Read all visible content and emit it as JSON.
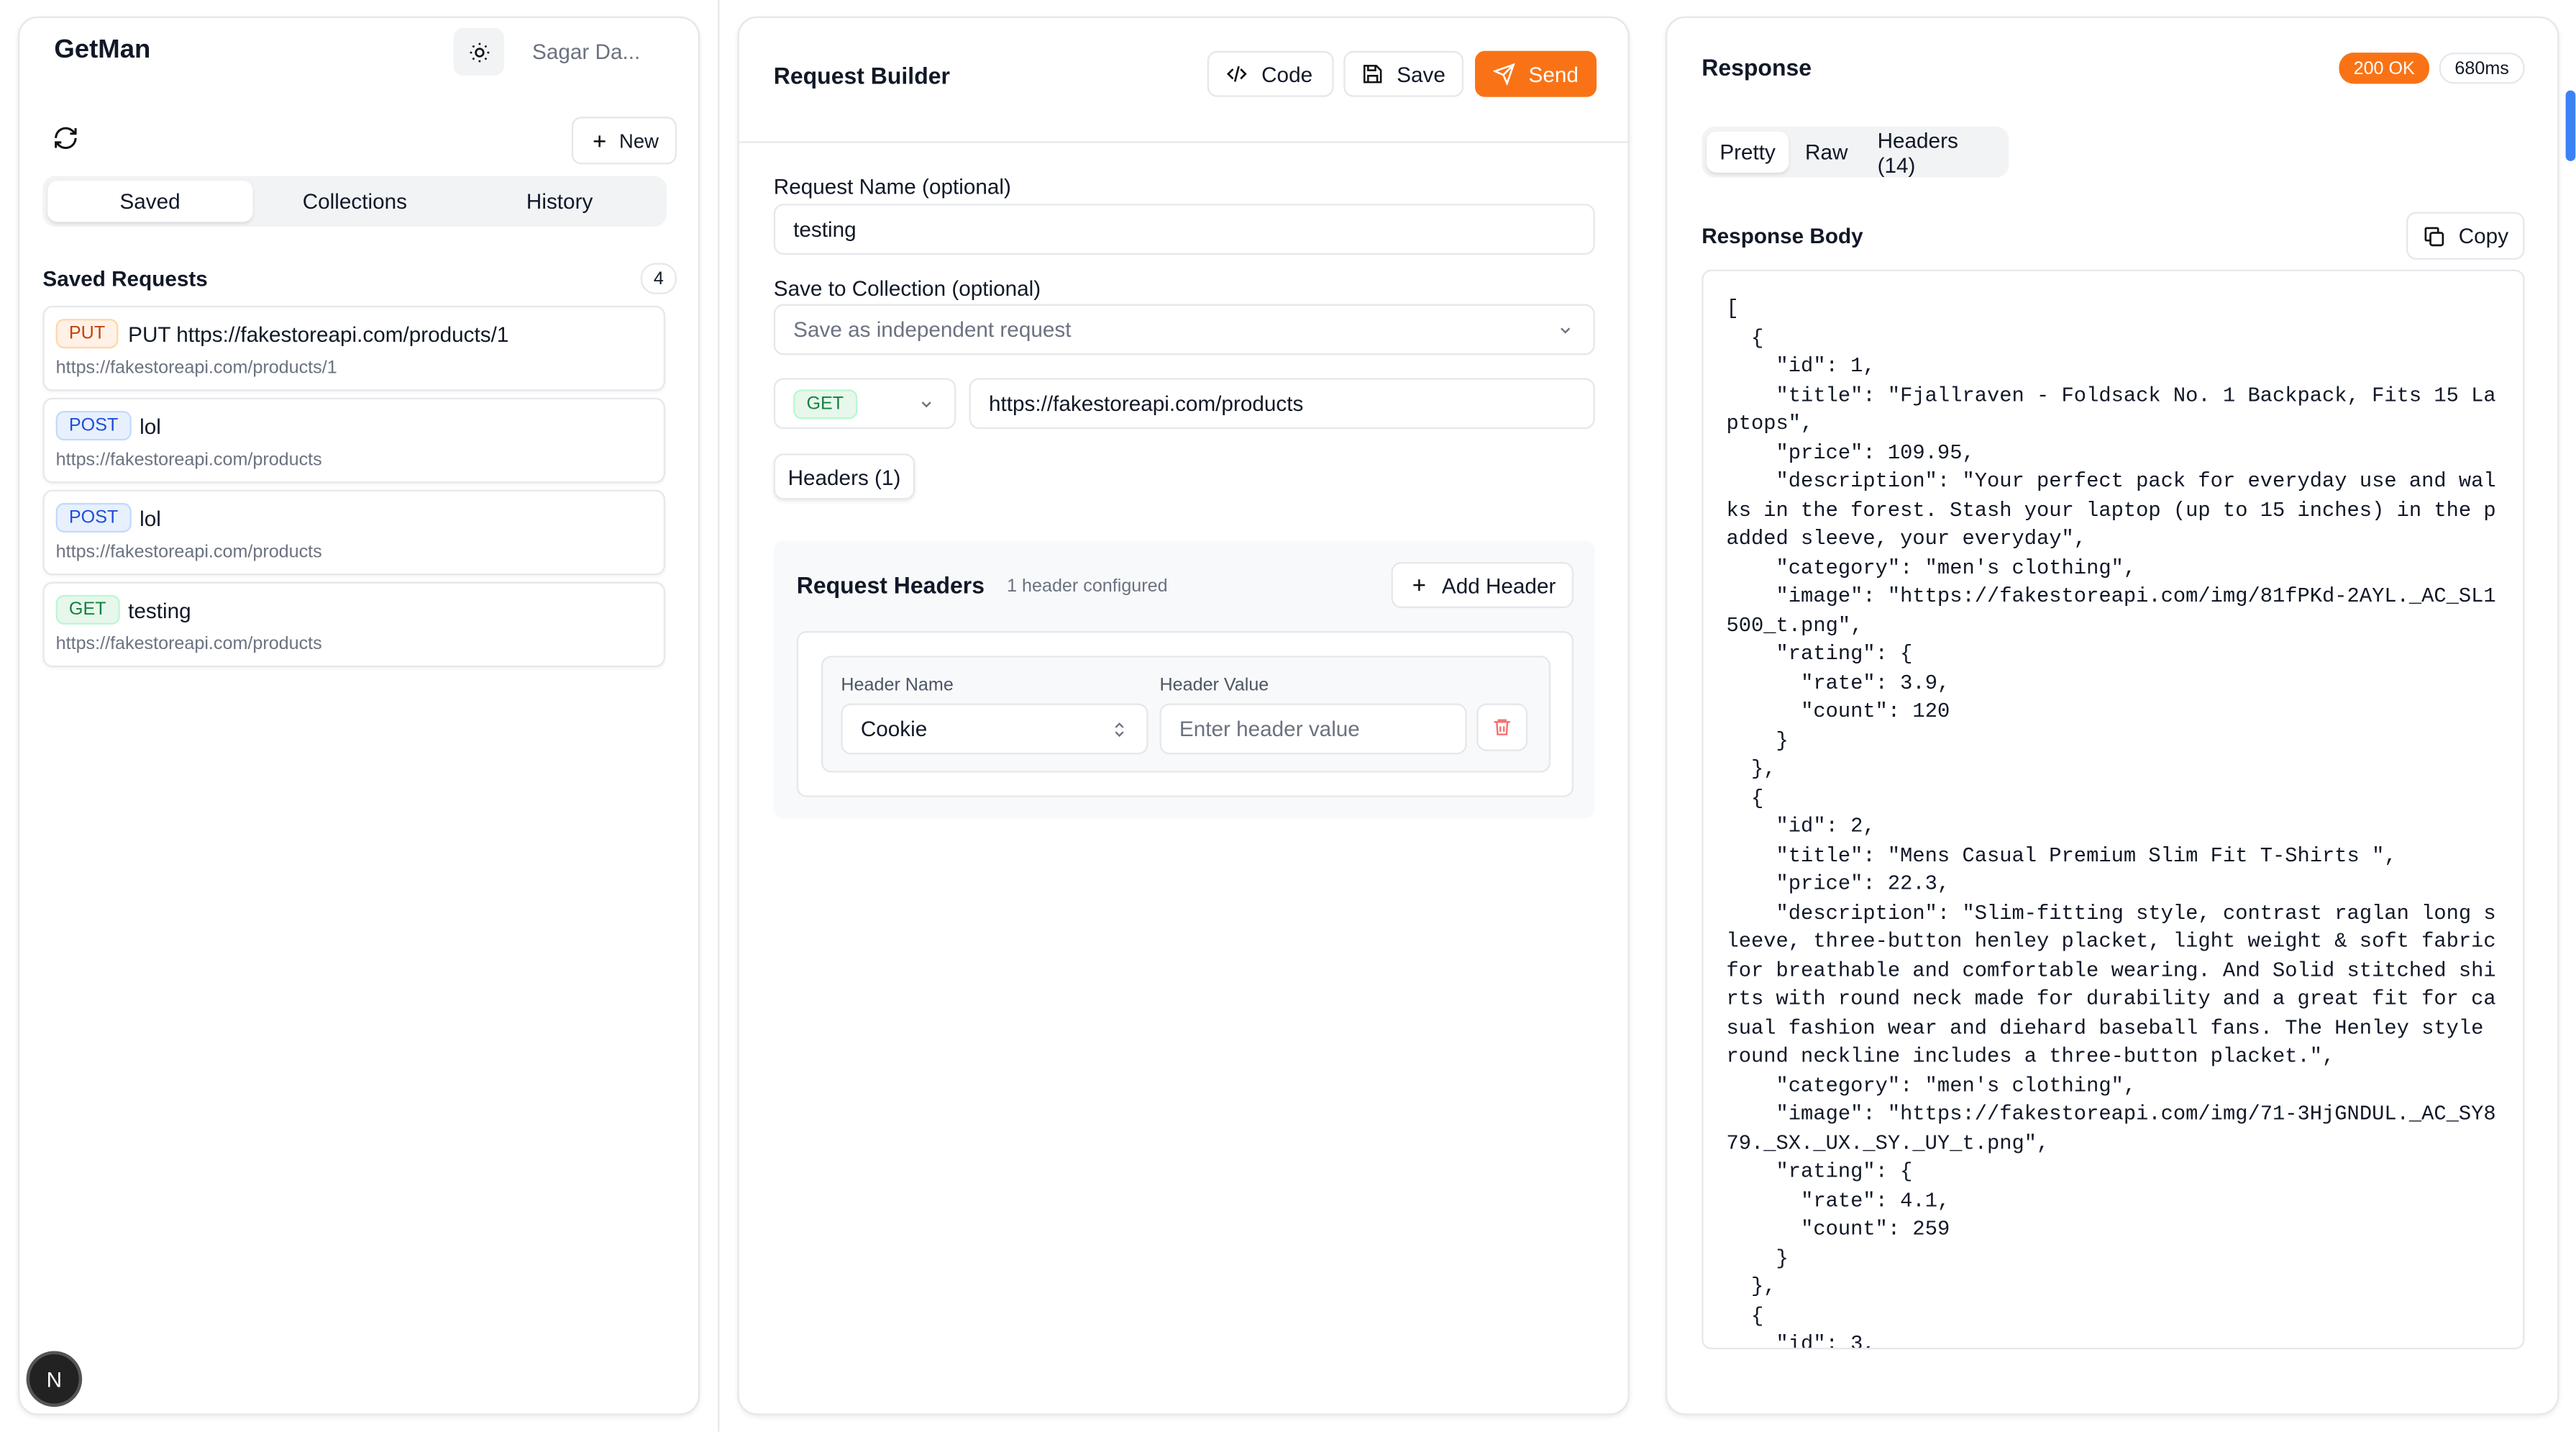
{
  "sidebar": {
    "brand": "GetMan",
    "user": "Sagar Da...",
    "new_label": "New",
    "tabs": [
      "Saved",
      "Collections",
      "History"
    ],
    "section_title": "Saved Requests",
    "count": "4",
    "requests": [
      {
        "method": "PUT",
        "name": "PUT https://fakestoreapi.com/products/1",
        "url": "https://fakestoreapi.com/products/1"
      },
      {
        "method": "POST",
        "name": "lol",
        "url": "https://fakestoreapi.com/products"
      },
      {
        "method": "POST",
        "name": "lol",
        "url": "https://fakestoreapi.com/products"
      },
      {
        "method": "GET",
        "name": "testing",
        "url": "https://fakestoreapi.com/products"
      }
    ],
    "fab_label": "N"
  },
  "builder": {
    "title": "Request Builder",
    "code_label": "Code",
    "save_label": "Save",
    "send_label": "Send",
    "name_label": "Request Name (optional)",
    "name_value": "testing",
    "collection_label": "Save to Collection (optional)",
    "collection_placeholder": "Save as independent request",
    "method": "GET",
    "url": "https://fakestoreapi.com/products",
    "headers_tab": "Headers (1)",
    "headers_section": {
      "title": "Request Headers",
      "subtitle": "1 header configured",
      "add_label": "Add Header",
      "name_label": "Header Name",
      "value_label": "Header Value",
      "name_value": "Cookie",
      "value_placeholder": "Enter header value"
    }
  },
  "response": {
    "title": "Response",
    "status": "200 OK",
    "time": "680ms",
    "tabs": [
      "Pretty",
      "Raw",
      "Headers (14)"
    ],
    "body_label": "Response Body",
    "copy_label": "Copy",
    "body": "[\n  {\n    \"id\": 1,\n    \"title\": \"Fjallraven - Foldsack No. 1 Backpack, Fits 15 Laptops\",\n    \"price\": 109.95,\n    \"description\": \"Your perfect pack for everyday use and walks in the forest. Stash your laptop (up to 15 inches) in the padded sleeve, your everyday\",\n    \"category\": \"men's clothing\",\n    \"image\": \"https://fakestoreapi.com/img/81fPKd-2AYL._AC_SL1500_t.png\",\n    \"rating\": {\n      \"rate\": 3.9,\n      \"count\": 120\n    }\n  },\n  {\n    \"id\": 2,\n    \"title\": \"Mens Casual Premium Slim Fit T-Shirts \",\n    \"price\": 22.3,\n    \"description\": \"Slim-fitting style, contrast raglan long sleeve, three-button henley placket, light weight & soft fabric for breathable and comfortable wearing. And Solid stitched shirts with round neck made for durability and a great fit for casual fashion wear and diehard baseball fans. The Henley style round neckline includes a three-button placket.\",\n    \"category\": \"men's clothing\",\n    \"image\": \"https://fakestoreapi.com/img/71-3HjGNDUL._AC_SY879._SX._UX._SY._UY_t.png\",\n    \"rating\": {\n      \"rate\": 4.1,\n      \"count\": 259\n    }\n  },\n  {\n    \"id\": 3,"
  },
  "colors": {
    "accent": "#f97316",
    "put": "#c2410c",
    "post": "#1d4ed8",
    "get": "#15803d"
  }
}
